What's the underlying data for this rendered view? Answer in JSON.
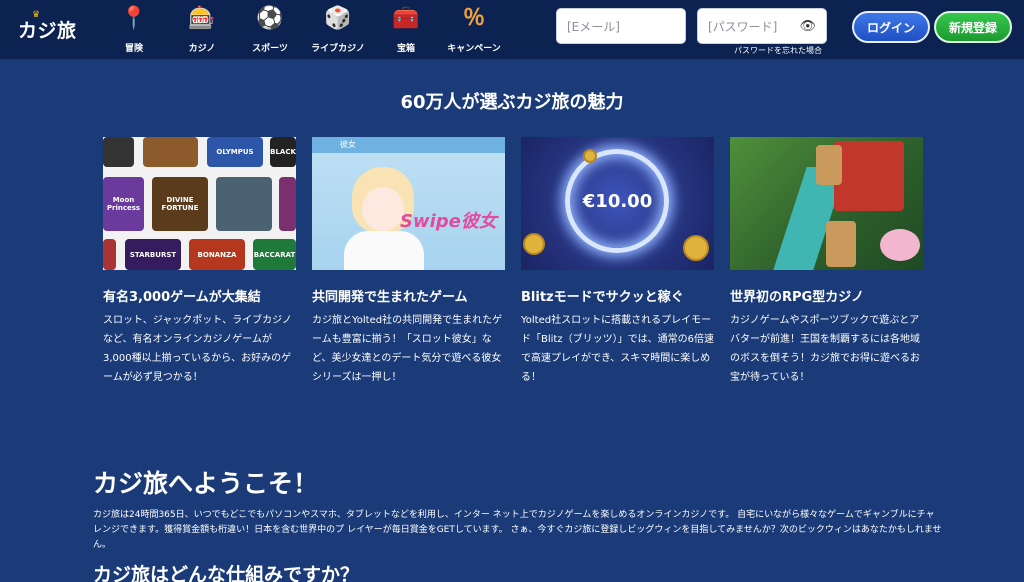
{
  "header": {
    "logo": "カジ旅",
    "nav": [
      {
        "label": "冒険",
        "icon": "map-pin-icon",
        "glyph": "📍"
      },
      {
        "label": "カジノ",
        "icon": "slot-machine-icon",
        "glyph": "🎰"
      },
      {
        "label": "スポーツ",
        "icon": "soccer-ball-icon",
        "glyph": "⚽"
      },
      {
        "label": "ライブカジノ",
        "icon": "roulette-table-icon",
        "glyph": "🎲"
      },
      {
        "label": "宝箱",
        "icon": "treasure-chest-icon",
        "glyph": "🧰"
      },
      {
        "label": "キャンペーン",
        "icon": "percent-badge-icon",
        "glyph": "％"
      }
    ],
    "email_placeholder": "[Eメール]",
    "password_placeholder": "[パスワード]",
    "forgot_password": "パスワードを忘れた場合",
    "login_label": "ログイン",
    "register_label": "新規登録"
  },
  "features": {
    "title": "60万人が選ぶカジ旅の魅力",
    "cards": [
      {
        "title": "有名3,000ゲームが大集結",
        "desc": "スロット、ジャックポット、ライブカジノなど、有名オンラインカジノゲームが3,000種以上揃っているから、お好みのゲームが必ず見つかる！",
        "tiles": [
          "OLYMPUS",
          "Moon Princess",
          "DIVINE FORTUNE",
          "STARBURST",
          "BONANZA",
          "BACCARAT",
          "BLACK"
        ]
      },
      {
        "title": "共同開発で生まれたゲーム",
        "desc": "カジ旅とYolted社の共同開発で生まれたゲームも豊富に揃う！「スロット彼女」など、美少女達とのデート気分で遊べる彼女シリーズは一押し！",
        "logo_text": "Swipe彼女",
        "badge": "彼女"
      },
      {
        "title": "Blitzモードでサクッと稼ぐ",
        "desc": "Yolted社スロットに搭載されるプレイモード「Blitz（ブリッツ）」では、通常の6倍速で高速プレイができ、スキマ時間に楽しめる！",
        "amount": "€10.00"
      },
      {
        "title": "世界初のRPG型カジノ",
        "desc": "カジノゲームやスポーツブックで遊ぶとアバターが前進！王国を制覇するには各地域のボスを倒そう！カジ旅でお得に遊べるお宝が待っている！"
      }
    ]
  },
  "welcome": {
    "title": "カジ旅へようこそ！",
    "text": "カジ旅は24時間365日、いつでもどこでもパソコンやスマホ、タブレットなどを利用し、インター ネット上でカジノゲームを楽しめるオンラインカジノです。 自宅にいながら様々なゲームでギャンブルにチャレンジできます。獲得賞金額も桁違い！日本を含む世界中のプ レイヤーが毎日賞金をGETしています。 さぁ、今すぐカジ旅に登録しビッグウィンを目指してみませんか？次のビックウィンはあなたかもしれません。",
    "next_title": "カジ旅はどんな仕組みですか？"
  },
  "colors": {
    "background": "#1b3b78",
    "header": "#0c2250",
    "login": "#2a5fd6",
    "register": "#28b43c"
  }
}
